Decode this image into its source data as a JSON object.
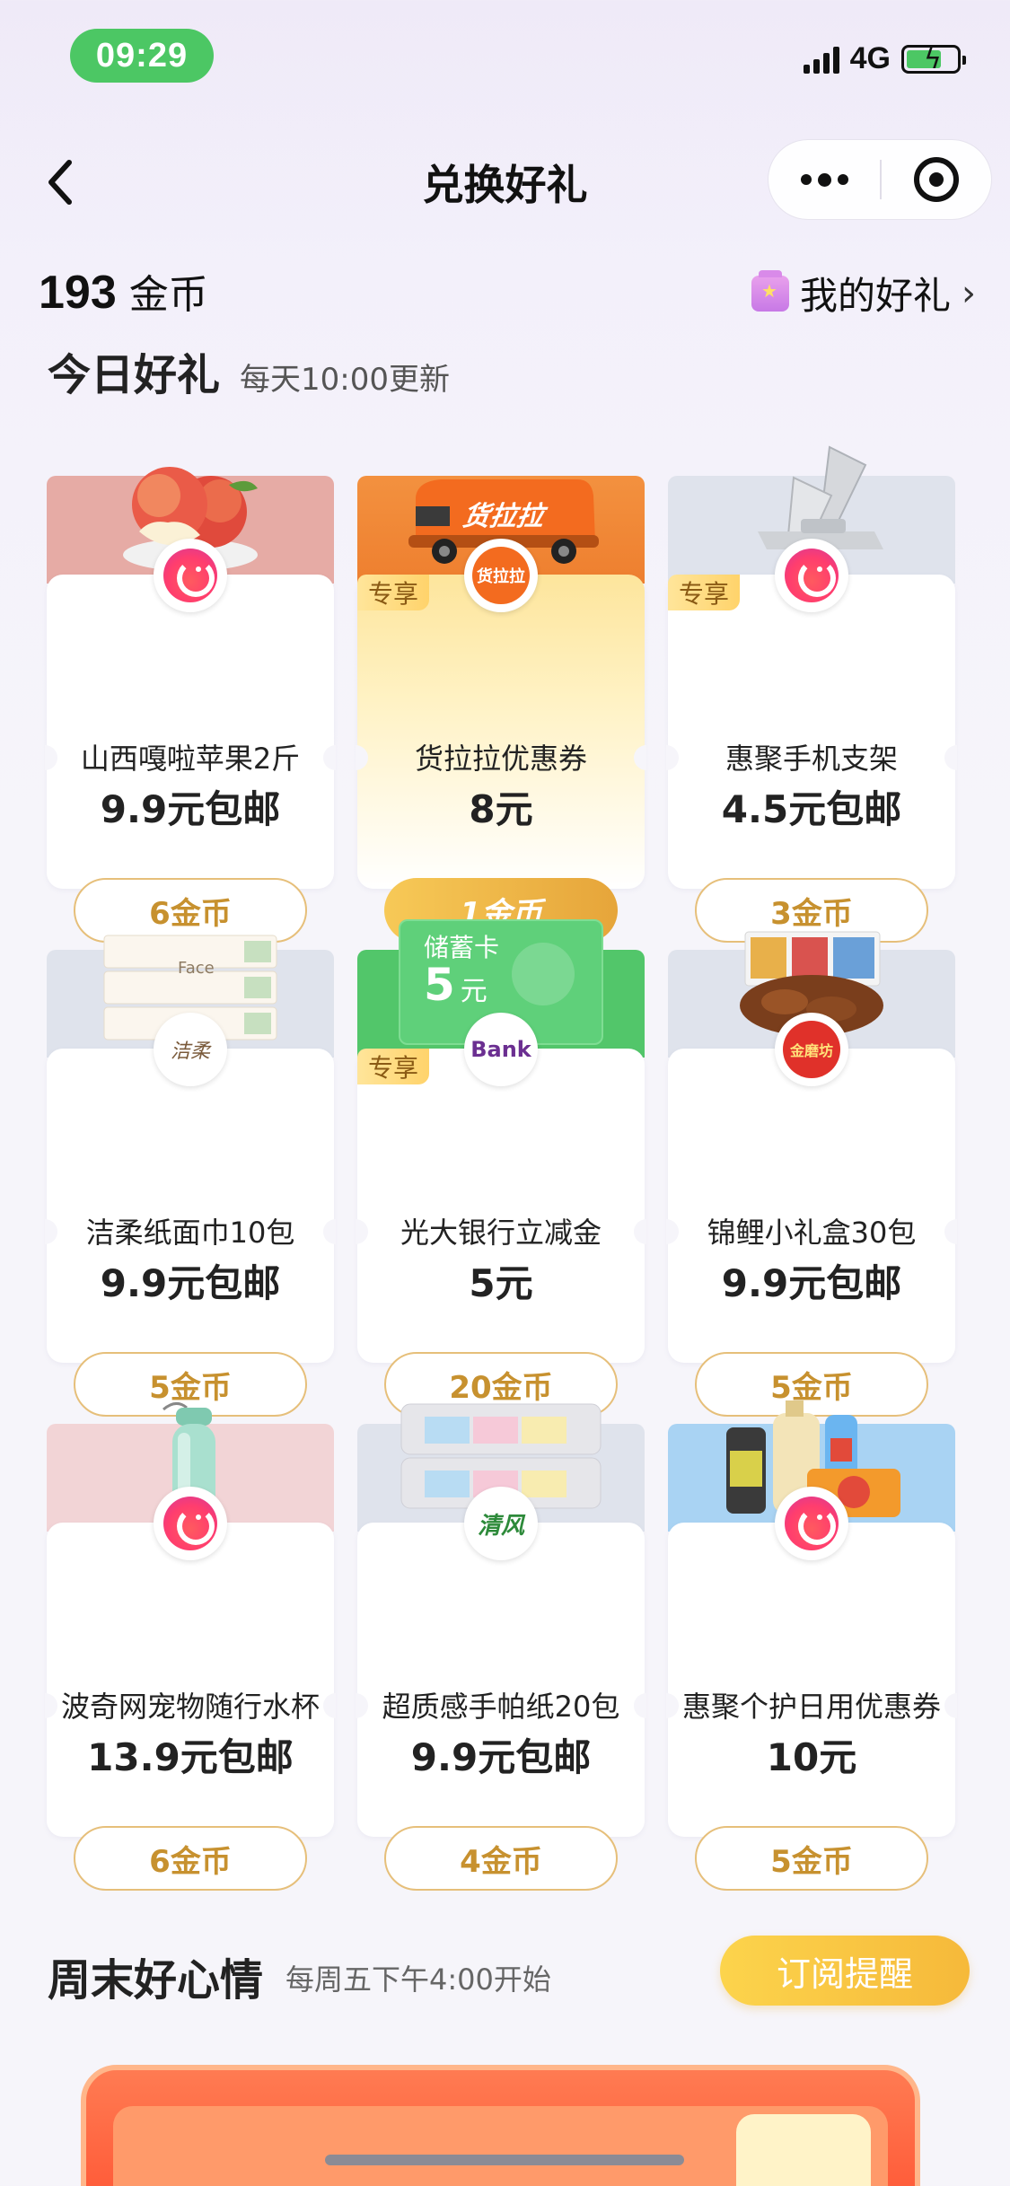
{
  "status": {
    "time": "09:29",
    "network": "4G"
  },
  "nav": {
    "title": "兑换好礼"
  },
  "account": {
    "coins": "193",
    "coin_unit": "金币",
    "my_gifts_label": "我的好礼"
  },
  "today": {
    "title": "今日好礼",
    "subtitle": "每天10:00更新"
  },
  "cards": [
    {
      "name": "山西嘎啦苹果2斤",
      "price": "9.9元包邮",
      "cost": "6金币",
      "tag": ""
    },
    {
      "name": "货拉拉优惠券",
      "price": "8元",
      "cost": "1金币",
      "tag": "专享",
      "logo_text": "货拉拉",
      "vehicle_text": "货拉拉"
    },
    {
      "name": "惠聚手机支架",
      "price": "4.5元包邮",
      "cost": "3金币",
      "tag": "专享"
    },
    {
      "name": "洁柔纸面巾10包",
      "price": "9.9元包邮",
      "cost": "5金币",
      "tag": "",
      "logo_text": "洁柔",
      "pack_text": "Face"
    },
    {
      "name": "光大银行立减金",
      "price": "5元",
      "cost": "20金币",
      "tag": "专享",
      "logo_text": "Bank",
      "card_label": "储蓄卡",
      "card_amount": "5",
      "card_unit": "元"
    },
    {
      "name": "锦鲤小礼盒30包",
      "price": "9.9元包邮",
      "cost": "5金币",
      "tag": "",
      "logo_text": "金磨坊"
    },
    {
      "name": "波奇网宠物随行水杯",
      "price": "13.9元包邮",
      "cost": "6金币",
      "tag": ""
    },
    {
      "name": "超质感手帕纸20包",
      "price": "9.9元包邮",
      "cost": "4金币",
      "tag": "",
      "logo_text": "清风"
    },
    {
      "name": "惠聚个护日用优惠券",
      "price": "10元",
      "cost": "5金币",
      "tag": ""
    }
  ],
  "weekend": {
    "title": "周末好心情",
    "subtitle": "每周五下午4:00开始",
    "subscribe_label": "订阅提醒"
  },
  "colors": {
    "accent_gold": "#e6a53a",
    "status_green": "#4cc764",
    "huolala_orange": "#f07a2a",
    "bank_green": "#52c66a"
  }
}
